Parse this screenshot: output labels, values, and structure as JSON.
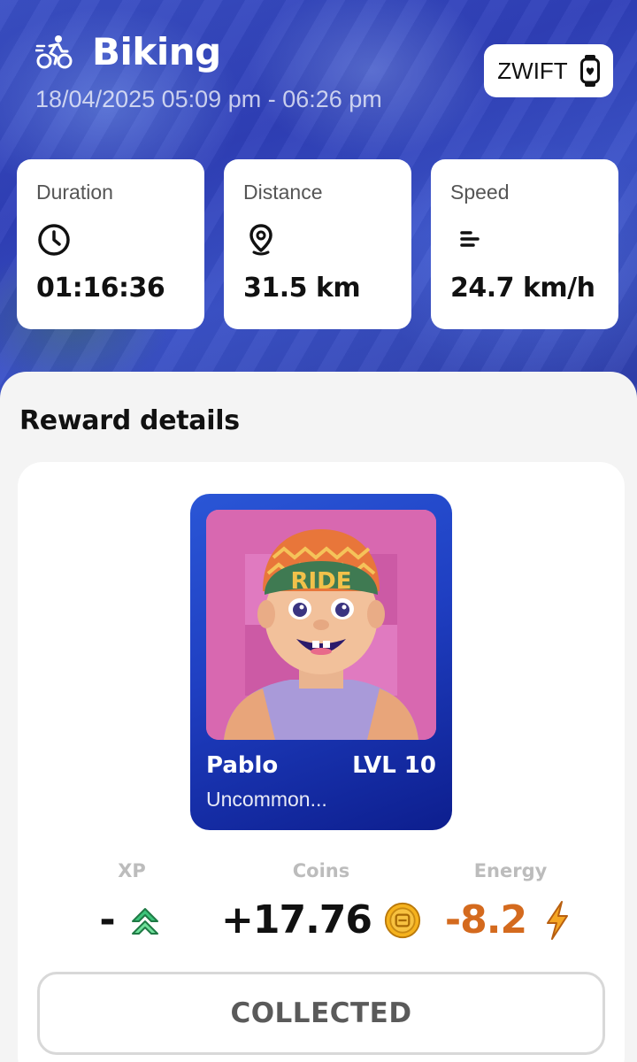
{
  "header": {
    "title": "Biking",
    "activity_icon": "cyclist-icon",
    "datetime": "18/04/2025 05:09 pm - 06:26 pm"
  },
  "device_badge": {
    "label": "ZWIFT",
    "icon": "smartwatch-icon"
  },
  "stats": [
    {
      "label": "Duration",
      "icon": "clock-icon",
      "value": "01:16:36"
    },
    {
      "label": "Distance",
      "icon": "location-pin-icon",
      "value": "31.5 km"
    },
    {
      "label": "Speed",
      "icon": "speed-lines-icon",
      "value": "24.7 km/h"
    }
  ],
  "reward_section": {
    "title": "Reward details"
  },
  "nft_card": {
    "cap_text": "RIDE",
    "name": "Pablo",
    "level": "LVL 10",
    "rarity": "Uncommon..."
  },
  "rewards": {
    "xp": {
      "label": "XP",
      "value": "-",
      "icon": "double-chevron-up-icon",
      "color": "#111111"
    },
    "coins": {
      "label": "Coins",
      "value": "+17.76",
      "icon": "coin-icon",
      "color": "#111111"
    },
    "energy": {
      "label": "Energy",
      "value": "-8.2",
      "icon": "lightning-icon",
      "color": "#d46a1e"
    }
  },
  "collect_button": {
    "label": "COLLECTED"
  },
  "colors": {
    "hero_blue": "#2f3fb8",
    "card_blue": "#1f3fc2",
    "energy_orange": "#d46a1e",
    "coin_gold": "#f5b21d"
  }
}
